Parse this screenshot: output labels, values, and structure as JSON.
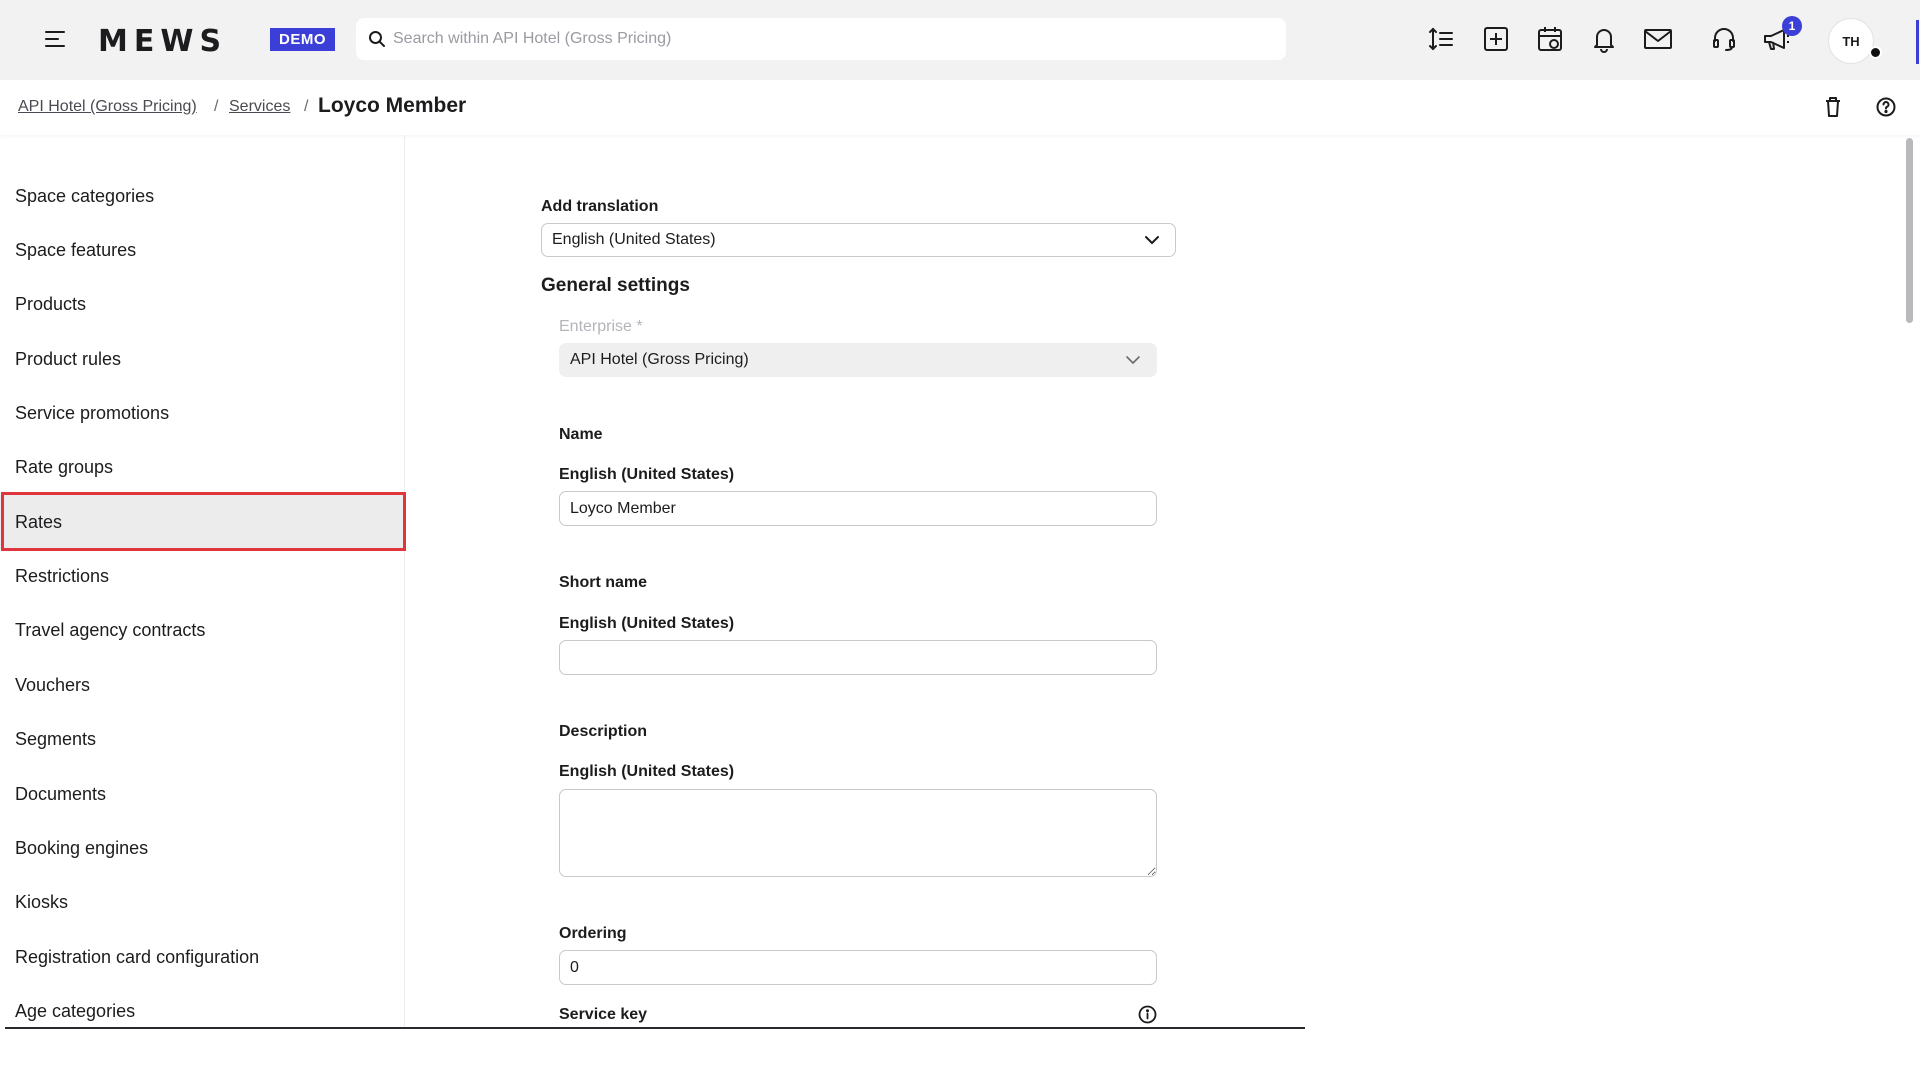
{
  "topbar": {
    "logo": "MEWS",
    "badge": "DEMO",
    "search_placeholder": "Search within API Hotel (Gross Pricing)",
    "notifications_count": "1",
    "avatar_initials": "TH"
  },
  "breadcrumb": {
    "items": [
      "API Hotel (Gross Pricing)",
      "Services"
    ],
    "separator": "/",
    "current": "Loyco Member"
  },
  "sidebar": {
    "items": [
      {
        "label": "Space categories"
      },
      {
        "label": "Space features"
      },
      {
        "label": "Products"
      },
      {
        "label": "Product rules"
      },
      {
        "label": "Service promotions"
      },
      {
        "label": "Rate groups"
      },
      {
        "label": "Rates"
      },
      {
        "label": "Restrictions"
      },
      {
        "label": "Travel agency contracts"
      },
      {
        "label": "Vouchers"
      },
      {
        "label": "Segments"
      },
      {
        "label": "Documents"
      },
      {
        "label": "Booking engines"
      },
      {
        "label": "Kiosks"
      },
      {
        "label": "Registration card configuration"
      },
      {
        "label": "Age categories"
      }
    ],
    "active": "Rates"
  },
  "form": {
    "translation_label": "Add translation",
    "translation_value": "English (United States)",
    "general_settings": "General settings",
    "enterprise_label": "Enterprise *",
    "enterprise_value": "API Hotel (Gross Pricing)",
    "name_label": "Name",
    "name_lang": "English (United States)",
    "name_value": "Loyco Member",
    "short_name_label": "Short name",
    "short_name_lang": "English (United States)",
    "short_name_value": "",
    "description_label": "Description",
    "description_lang": "English (United States)",
    "description_value": "",
    "ordering_label": "Ordering",
    "ordering_value": "0",
    "service_key_label": "Service key"
  },
  "colors": {
    "accent": "#3b3fd8",
    "active_outline": "#e0353d",
    "topbar_bg": "#f2f2f3"
  }
}
